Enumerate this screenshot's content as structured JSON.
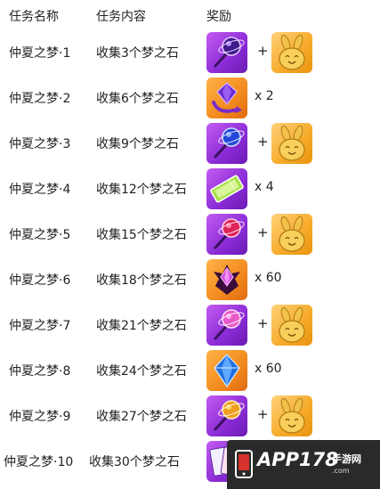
{
  "header": {
    "name": "任务名称",
    "content": "任务内容",
    "reward": "奖励"
  },
  "rows": [
    {
      "name": "仲夏之梦·1",
      "content": "收集3个梦之石",
      "reward_icon": "purple-orb-wand-icon",
      "extra": "+",
      "extra_icon": "golden-bunny-bag-icon"
    },
    {
      "name": "仲夏之梦·2",
      "content": "收集6个梦之石",
      "reward_icon": "purple-gem-arrow-icon",
      "extra": "x 2"
    },
    {
      "name": "仲夏之梦·3",
      "content": "收集9个梦之石",
      "reward_icon": "blue-orb-wand-icon",
      "extra": "+",
      "extra_icon": "golden-bunny-bag-icon"
    },
    {
      "name": "仲夏之梦·4",
      "content": "收集12个梦之石",
      "reward_icon": "green-ticket-icon",
      "extra": "x 4"
    },
    {
      "name": "仲夏之梦·5",
      "content": "收集15个梦之石",
      "reward_icon": "red-orb-wand-icon",
      "extra": "+",
      "extra_icon": "golden-bunny-bag-icon"
    },
    {
      "name": "仲夏之梦·6",
      "content": "收集18个梦之石",
      "reward_icon": "dark-crystal-flower-icon",
      "extra": "x 60"
    },
    {
      "name": "仲夏之梦·7",
      "content": "收集21个梦之石",
      "reward_icon": "pink-orb-wand-icon",
      "extra": "+",
      "extra_icon": "golden-bunny-bag-icon"
    },
    {
      "name": "仲夏之梦·8",
      "content": "收集24个梦之石",
      "reward_icon": "blue-diamond-icon",
      "extra": "x 60"
    },
    {
      "name": "仲夏之梦·9",
      "content": "收集27个梦之石",
      "reward_icon": "gold-orb-wand-icon",
      "extra": "+",
      "extra_icon": "golden-bunny-bag-icon"
    },
    {
      "name": "仲夏之梦·10",
      "content": "收集30个梦之石",
      "reward_icon": "card-pack-icon"
    }
  ],
  "watermark": {
    "logo": "APP178",
    "cn": "手游网",
    "url": ".com"
  }
}
